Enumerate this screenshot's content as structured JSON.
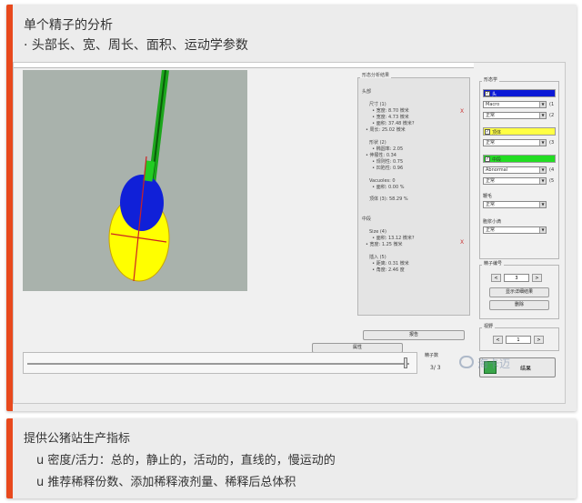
{
  "top_card": {
    "title": "单个精子的分析",
    "subtitle": "· 头部长、宽、周长、面积、运动学参数"
  },
  "results": {
    "group_title": "形态分析结果",
    "lines": [
      "头部",
      "尺寸 (1)",
      "  • 宽度: 8.70 微米",
      "  • 宽度: 4.73 微米",
      "  • 面积: 37.48 微米?",
      "• 周长: 25.02 微米",
      "形状 (2)",
      "  • 椭圆率: 2.05",
      "• 伸展性: 0.34",
      "  • 规则性: 0.75",
      "  • 凹陷性: 0.96",
      "Vacuoles: 0",
      "  • 面积: 0.00 %",
      "顶体 (3): 58.29 %",
      "中段",
      "Size (4)",
      "  • 面积: 13.12 微米?",
      "• 宽度: 1.25 微米",
      "插入 (5)",
      "  • 距离: 0.31 微米",
      "  • 角度: 2.46 度"
    ],
    "x_mark": "X",
    "report_button": "报告",
    "attr_button": "属性"
  },
  "kinematics": {
    "group_title": "形态学",
    "head_check": "头",
    "sel1": "Macro",
    "num1": "(1",
    "sel2": "正常",
    "num2": "(2",
    "acro_check": "顶体",
    "sel3": "正常",
    "num3": "(3",
    "mid_check": "中段",
    "sel4": "Abnormal",
    "num4": "(4",
    "sel5": "正常",
    "num5": "(5",
    "tail_label": "鞭毛",
    "sel6": "正常",
    "droplet_label": "胞浆小滴",
    "sel7": "正常",
    "arrow": "▼",
    "check": "✓"
  },
  "sperm_no": {
    "title": "精子编号",
    "prev": "<",
    "value": "3",
    "next": ">",
    "show_btn": "显示详细结果",
    "delete_btn": "删除"
  },
  "field": {
    "title": "视野",
    "prev": "<",
    "value": "1",
    "next": ">"
  },
  "slider": {
    "label": "精子数",
    "count": "3/ 3"
  },
  "save": {
    "label": "结果"
  },
  "watermark": "海卡迈",
  "bottom_card": {
    "line1": "提供公猪站生产指标",
    "line2": "u 密度/活力：总的，静止的，活动的，直线的，慢运动的",
    "line3": "u 推荐稀释份数、添加稀释液剂量、稀释后总体积"
  },
  "colors": {
    "accent": "#e8491d",
    "head_blue": "#0b18d6",
    "acrosome_yellow": "#ffff00",
    "midpiece_green": "#22cc22",
    "tail_green": "#22cc22",
    "axis_red": "#cc2222"
  }
}
